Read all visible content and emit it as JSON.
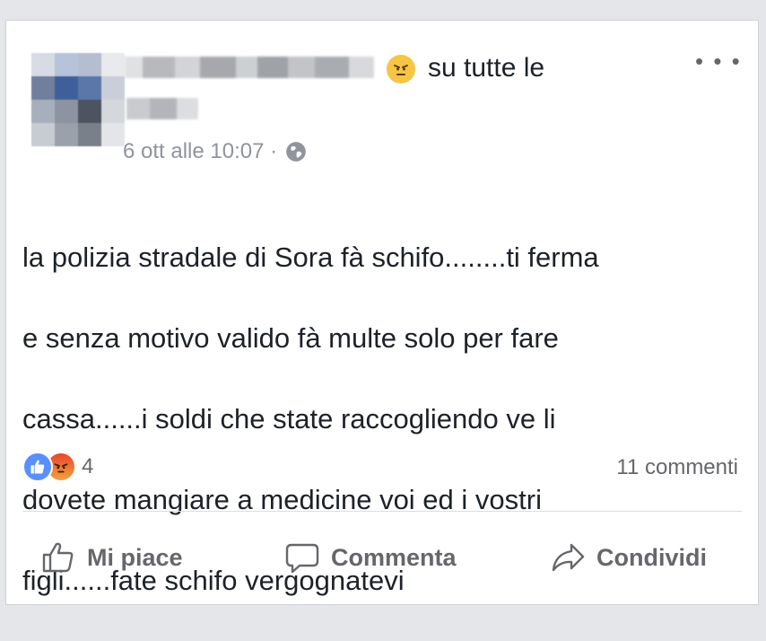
{
  "post": {
    "feeling_text": "su tutte le",
    "timestamp": "6 ott alle 10:07 ·",
    "privacy_icon": "globe-icon",
    "body_lines": [
      "la polizia stradale di Sora fà schifo........ti ferma",
      "e senza motivo valido fà  multe solo per fare",
      "cassa......i soldi che state raccogliendo ve li",
      "dovete mangiare a medicine voi ed i vostri",
      "figli......fate schifo vergognatevi"
    ]
  },
  "stats": {
    "reaction_icons": [
      "like-icon",
      "angry-icon"
    ],
    "reaction_count": "4",
    "comments": "11 commenti"
  },
  "actions": {
    "like": "Mi piace",
    "comment": "Commenta",
    "share": "Condividi"
  },
  "colors": {
    "like_blue": "#5890ff",
    "angry_red": "#e9442e",
    "emoji_yellow": "#f6c544",
    "meta_gray": "#90949c"
  }
}
